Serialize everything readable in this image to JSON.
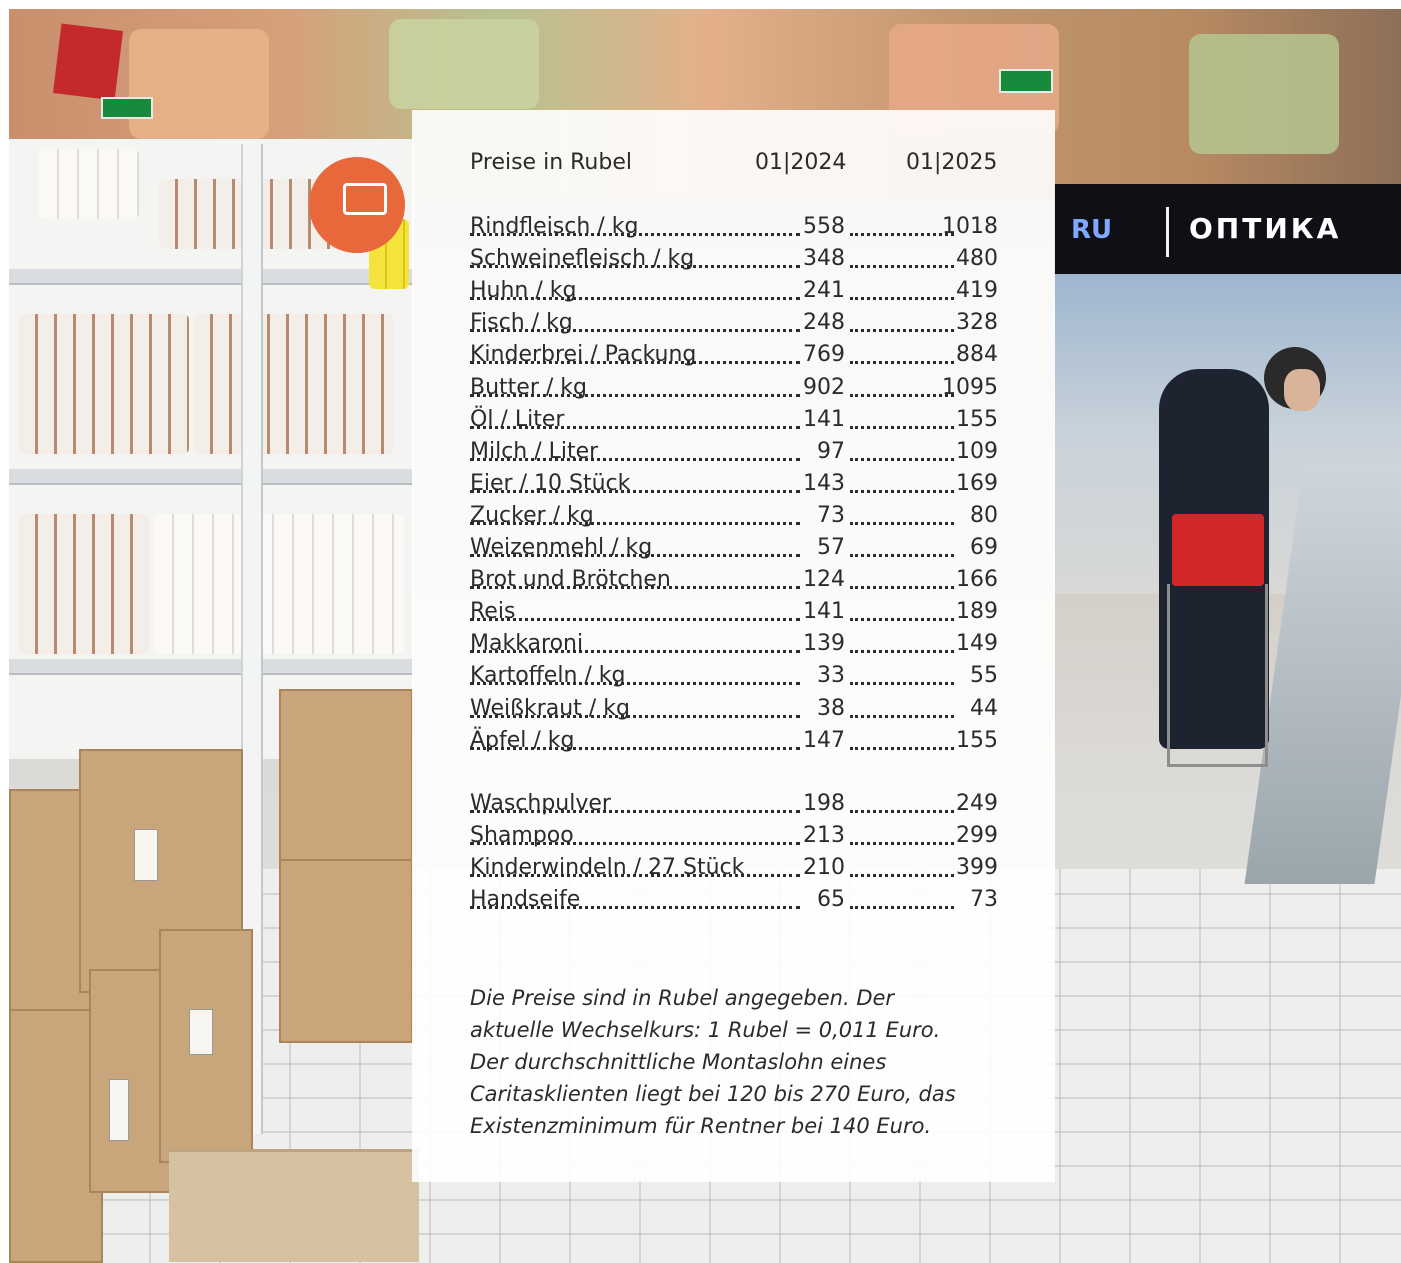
{
  "header": {
    "title": "Preise in Rubel",
    "col1": "01|2024",
    "col2": "01|2025"
  },
  "food_items": [
    {
      "label": "Rindfleisch / kg",
      "p2024": "558",
      "p2025": "1018"
    },
    {
      "label": "Schweinefleisch / kg",
      "p2024": "348",
      "p2025": "480"
    },
    {
      "label": "Huhn / kg",
      "p2024": "241",
      "p2025": "419"
    },
    {
      "label": "Fisch / kg",
      "p2024": "248",
      "p2025": "328"
    },
    {
      "label": "Kinderbrei / Packung",
      "p2024": "769",
      "p2025": "884"
    },
    {
      "label": "Butter / kg",
      "p2024": "902",
      "p2025": "1095"
    },
    {
      "label": "Öl / Liter",
      "p2024": "141",
      "p2025": "155"
    },
    {
      "label": "Milch / Liter",
      "p2024": "97",
      "p2025": "109"
    },
    {
      "label": "Eier / 10 Stück",
      "p2024": "143",
      "p2025": "169"
    },
    {
      "label": "Zucker / kg",
      "p2024": "73",
      "p2025": "80"
    },
    {
      "label": "Weizenmehl / kg",
      "p2024": "57",
      "p2025": "69"
    },
    {
      "label": "Brot und Brötchen",
      "p2024": "124",
      "p2025": "166"
    },
    {
      "label": "Reis",
      "p2024": "141",
      "p2025": "189"
    },
    {
      "label": "Makkaroni",
      "p2024": "139",
      "p2025": "149"
    },
    {
      "label": "Kartoffeln / kg",
      "p2024": "33",
      "p2025": "55"
    },
    {
      "label": "Weißkraut / kg",
      "p2024": "38",
      "p2025": "44"
    },
    {
      "label": "Äpfel / kg",
      "p2024": "147",
      "p2025": "155"
    }
  ],
  "household_items": [
    {
      "label": "Waschpulver",
      "p2024": "198",
      "p2025": "249"
    },
    {
      "label": "Shampoo",
      "p2024": "213",
      "p2025": "299"
    },
    {
      "label": "Kinderwindeln / 27 Stück",
      "p2024": "210",
      "p2025": "399"
    },
    {
      "label": "Handseife",
      "p2024": "65",
      "p2025": "73"
    }
  ],
  "note": "Die Preise sind in Rubel angegeben. Der\naktuelle Wechselkurs: 1 Rubel = 0,011 Euro.\nDer durchschnittliche Montaslohn eines\nCaritasklienten liegt bei 120 bis 270 Euro, das\nExistenzminimum für Rentner bei 140 Euro.",
  "background_photo": {
    "store_sign": "ОПТИКА",
    "store_sign_prefix": "RU",
    "colors": {
      "sign_bg": "#0e1016",
      "basket": "#d2282c",
      "exit_sign": "#188a3b"
    }
  }
}
